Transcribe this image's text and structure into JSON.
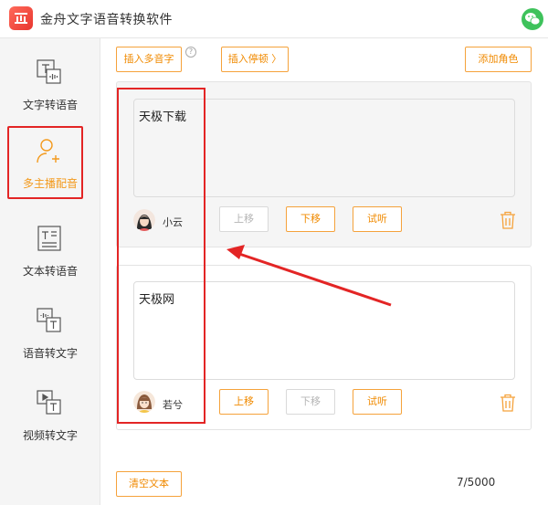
{
  "app": {
    "title": "金舟文字语音转换软件"
  },
  "sidebar": {
    "items": [
      {
        "label": "文字转语音",
        "icon": "text-to-speech-icon"
      },
      {
        "label": "多主播配音",
        "icon": "multi-speaker-icon",
        "active": true
      },
      {
        "label": "文本转语音",
        "icon": "document-to-speech-icon"
      },
      {
        "label": "语音转文字",
        "icon": "speech-to-text-icon"
      },
      {
        "label": "视频转文字",
        "icon": "video-to-text-icon"
      }
    ]
  },
  "toolbar": {
    "insert_polyphone": "插入多音字",
    "insert_pause": "插入停顿 〉",
    "add_role": "添加角色"
  },
  "cards": [
    {
      "text": "天极下载",
      "speaker": "小云",
      "move_up": "上移",
      "move_down": "下移",
      "preview": "试听",
      "move_up_enabled": false,
      "move_down_enabled": true
    },
    {
      "text": "天极网",
      "speaker": "若兮",
      "move_up": "上移",
      "move_down": "下移",
      "preview": "试听",
      "move_up_enabled": true,
      "move_down_enabled": false
    }
  ],
  "footer": {
    "clear_text": "清空文本",
    "char_count": "7/5000"
  },
  "colors": {
    "accent": "#f08a00",
    "annotation_red": "#e32525",
    "wechat_green": "#3ec25b"
  }
}
